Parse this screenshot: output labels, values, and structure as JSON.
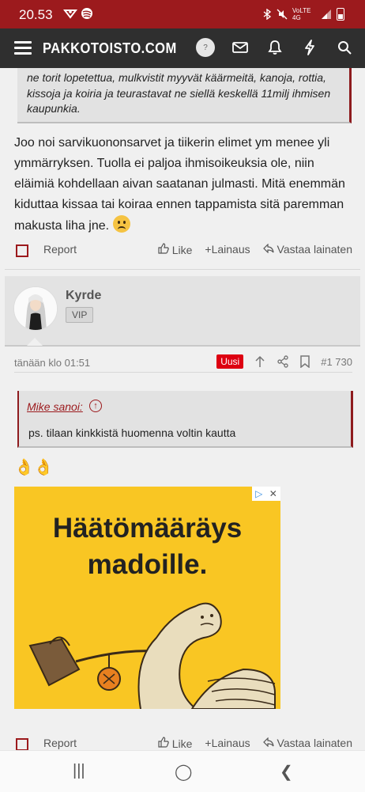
{
  "status_bar": {
    "time": "20.53",
    "left_icons": "↯ ●",
    "network": "VoLTE 4G"
  },
  "site": {
    "logo": "PAKKOTOISTO.COM",
    "avatar_label": "?"
  },
  "post1": {
    "quote_lines": [
      "ne torit lopetettua, mulkvistit myyvät käärmeitä, kanoja, rottia,",
      "kissoja ja koiria ja teurastavat ne siellä keskellä 11milj ihmisen",
      "kaupunkia."
    ],
    "text": "Joo noi sarvikuononsarvet ja tiikerin elimet ym menee yli ymmärryksen. Tuolla ei paljoa ihmisoikeuksia ole, niin eläimiä kohdellaan aivan saatanan julmasti. Mitä enemmän kiduttaa kissaa tai koiraa ennen tappamista sitä paremman makusta liha jne.",
    "actions": {
      "report": "Report",
      "like": "Like",
      "quote": "Lainaus",
      "reply": "Vastaa lainaten"
    }
  },
  "post2": {
    "username": "Kyrde",
    "badge": "VIP",
    "date": "tänään klo 01:51",
    "new_label": "Uusi",
    "post_number": "#1 730",
    "quote_attribution": "Mike sanoi:",
    "quote_text": "ps. tilaan kinkkistä huomenna voltin kautta",
    "emoji": "👌👌",
    "ad": {
      "line1": "Häätömääräys",
      "line2": "madoille.",
      "badge_arrow": "▷",
      "badge_close": "✕"
    },
    "actions": {
      "report": "Report",
      "like": "Like",
      "quote": "Lainaus",
      "reply": "Vastaa lainaten"
    }
  },
  "bottom_nav": {
    "recent": "|||",
    "home": "◯",
    "back": "❮"
  }
}
